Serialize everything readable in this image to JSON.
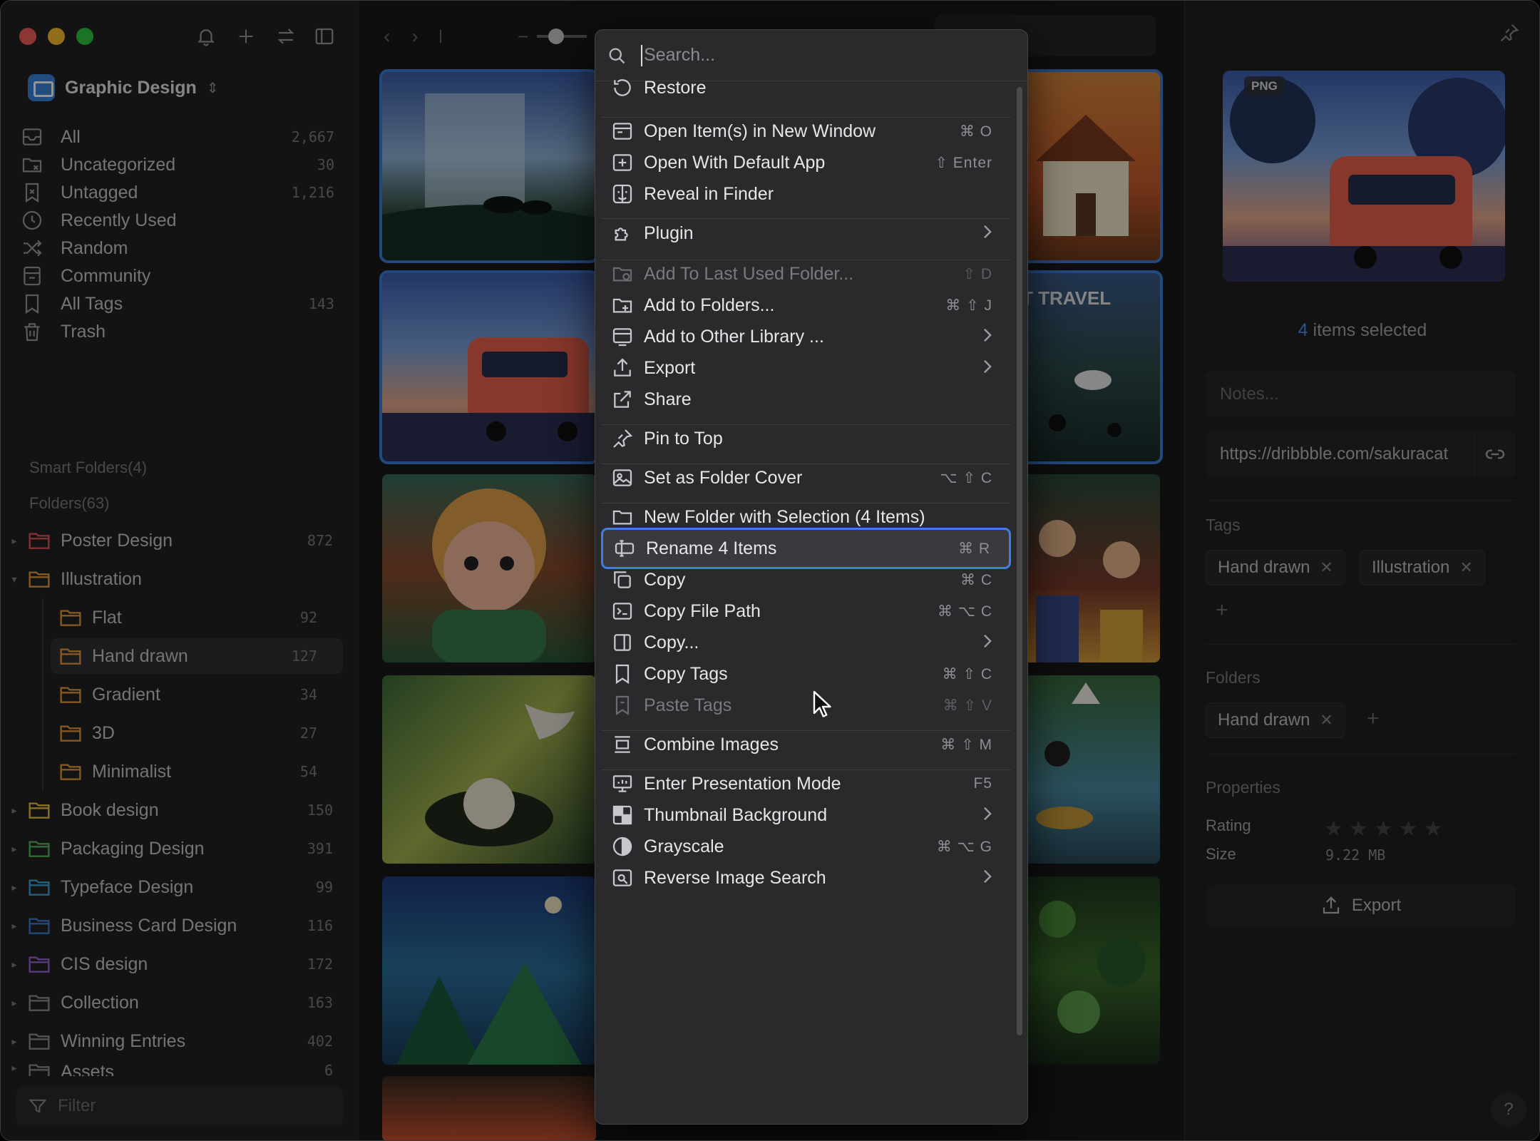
{
  "sidebar": {
    "library": {
      "name": "Graphic Design",
      "caret": "⌃"
    },
    "nav": [
      {
        "label": "All",
        "count": "2,667",
        "icon": "all-icon"
      },
      {
        "label": "Uncategorized",
        "count": "30",
        "icon": "uncategorized-icon"
      },
      {
        "label": "Untagged",
        "count": "1,216",
        "icon": "untagged-icon"
      },
      {
        "label": "Recently Used",
        "count": "",
        "icon": "clock-icon"
      },
      {
        "label": "Random",
        "count": "",
        "icon": "shuffle-icon"
      },
      {
        "label": "Community",
        "count": "",
        "icon": "community-icon"
      },
      {
        "label": "All Tags",
        "count": "143",
        "icon": "bookmark-icon"
      },
      {
        "label": "Trash",
        "count": "",
        "icon": "trash-icon"
      }
    ],
    "smart_folders": "Smart Folders(4)",
    "folders_heading": "Folders(63)",
    "folders": [
      {
        "label": "Poster Design",
        "count": "872",
        "color": "#e0565b"
      },
      {
        "label": "Illustration",
        "count": "",
        "color": "#e59a3e"
      },
      {
        "label": "Flat",
        "count": "92",
        "color": "#e59a3e"
      },
      {
        "label": "Hand drawn",
        "count": "127",
        "color": "#e59a3e"
      },
      {
        "label": "Gradient",
        "count": "34",
        "color": "#e59a3e"
      },
      {
        "label": "3D",
        "count": "27",
        "color": "#e59a3e"
      },
      {
        "label": "Minimalist",
        "count": "54",
        "color": "#e59a3e"
      },
      {
        "label": "Book design",
        "count": "150",
        "color": "#e8c13b"
      },
      {
        "label": "Packaging Design",
        "count": "391",
        "color": "#57b65a"
      },
      {
        "label": "Typeface Design",
        "count": "99",
        "color": "#3fa4d8"
      },
      {
        "label": "Business Card Design",
        "count": "116",
        "color": "#3d7dd8"
      },
      {
        "label": "CIS design",
        "count": "172",
        "color": "#9a62d6"
      },
      {
        "label": "Collection",
        "count": "163",
        "color": "#8e8e93"
      },
      {
        "label": "Winning Entries",
        "count": "402",
        "color": "#8e8e93"
      },
      {
        "label": "Assets",
        "count": "6",
        "color": "#8e8e93"
      }
    ],
    "filter_placeholder": "Filter"
  },
  "main": {
    "search_placeholder": "Search"
  },
  "context_menu": {
    "search_placeholder": "Search...",
    "items": [
      {
        "label": "Restore",
        "shortcut": "",
        "submenu": false,
        "disabled": false,
        "icon": "restore-icon"
      },
      {
        "label": "Open Item(s) in New Window",
        "shortcut": "⌘ O",
        "submenu": false,
        "disabled": false,
        "icon": "new-window-icon"
      },
      {
        "label": "Open With Default App",
        "shortcut": "⇧ Enter",
        "submenu": false,
        "disabled": false,
        "icon": "open-app-icon"
      },
      {
        "label": "Reveal in Finder",
        "shortcut": "",
        "submenu": false,
        "disabled": false,
        "icon": "finder-icon"
      },
      {
        "label": "Plugin",
        "shortcut": "",
        "submenu": true,
        "disabled": false,
        "icon": "plugin-icon"
      },
      {
        "label": "Add To Last Used Folder...",
        "shortcut": "⇧ D",
        "submenu": false,
        "disabled": true,
        "icon": "folder-clock-icon"
      },
      {
        "label": "Add to Folders...",
        "shortcut": "⌘ ⇧ J",
        "submenu": false,
        "disabled": false,
        "icon": "folder-add-icon"
      },
      {
        "label": "Add to Other Library ...",
        "shortcut": "",
        "submenu": true,
        "disabled": false,
        "icon": "library-icon"
      },
      {
        "label": "Export",
        "shortcut": "",
        "submenu": true,
        "disabled": false,
        "icon": "export-icon"
      },
      {
        "label": "Share",
        "shortcut": "",
        "submenu": false,
        "disabled": false,
        "icon": "share-icon"
      },
      {
        "label": "Pin to Top",
        "shortcut": "",
        "submenu": false,
        "disabled": false,
        "icon": "pin-icon"
      },
      {
        "label": "Set as Folder Cover",
        "shortcut": "⌥ ⇧ C",
        "submenu": false,
        "disabled": false,
        "icon": "image-icon"
      },
      {
        "label": "New Folder with Selection (4 Items)",
        "shortcut": "",
        "submenu": false,
        "disabled": false,
        "icon": "folder-new-icon"
      },
      {
        "label": "Rename 4 Items",
        "shortcut": "⌘ R",
        "submenu": false,
        "disabled": false,
        "icon": "rename-icon"
      },
      {
        "label": "Copy",
        "shortcut": "⌘ C",
        "submenu": false,
        "disabled": false,
        "icon": "copy-icon"
      },
      {
        "label": "Copy File Path",
        "shortcut": "⌘ ⌥ C",
        "submenu": false,
        "disabled": false,
        "icon": "terminal-icon"
      },
      {
        "label": "Copy...",
        "shortcut": "",
        "submenu": true,
        "disabled": false,
        "icon": "copy-more-icon"
      },
      {
        "label": "Copy Tags",
        "shortcut": "⌘ ⇧ C",
        "submenu": false,
        "disabled": false,
        "icon": "tag-copy-icon"
      },
      {
        "label": "Paste Tags",
        "shortcut": "⌘ ⇧ V",
        "submenu": false,
        "disabled": true,
        "icon": "tag-paste-icon"
      },
      {
        "label": "Combine Images",
        "shortcut": "⌘ ⇧ M",
        "submenu": false,
        "disabled": false,
        "icon": "combine-icon"
      },
      {
        "label": "Enter Presentation Mode",
        "shortcut": "F5",
        "submenu": false,
        "disabled": false,
        "icon": "presentation-icon"
      },
      {
        "label": "Thumbnail Background",
        "shortcut": "",
        "submenu": true,
        "disabled": false,
        "icon": "checker-icon"
      },
      {
        "label": "Grayscale",
        "shortcut": "⌘ ⌥ G",
        "submenu": false,
        "disabled": false,
        "icon": "grayscale-icon"
      },
      {
        "label": "Reverse Image Search",
        "shortcut": "",
        "submenu": true,
        "disabled": false,
        "icon": "image-search-icon"
      }
    ],
    "active_index": 13
  },
  "inspector": {
    "badge": "PNG",
    "selected_count": "4",
    "selected_suffix": "items selected",
    "notes_placeholder": "Notes...",
    "url": "https://dribbble.com/sakuracat",
    "tags_heading": "Tags",
    "tags": [
      "Hand drawn",
      "Illustration"
    ],
    "folders_heading": "Folders",
    "folders": [
      "Hand drawn"
    ],
    "properties_heading": "Properties",
    "rating_label": "Rating",
    "rating": 0,
    "rating_max": 5,
    "size_label": "Size",
    "size_value": "9.22 MB",
    "export_label": "Export",
    "help": "?"
  },
  "colors": {
    "accent": "#3f7fe0",
    "selection_count": "#4b8ff0"
  }
}
